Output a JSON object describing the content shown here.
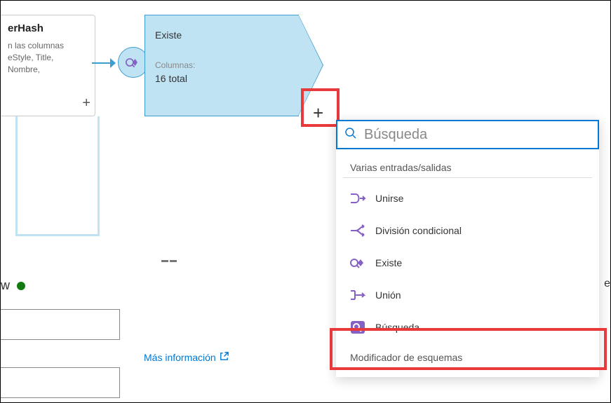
{
  "leftNode": {
    "titleFragment": "erHash",
    "descFragment": "n las columnas\neStyle, Title,\n Nombre,"
  },
  "existsNode": {
    "title": "Existe",
    "columnsLabel": "Columnas:",
    "columnsValue": "16 total"
  },
  "search": {
    "placeholder": "Búsqueda"
  },
  "menu": {
    "sectionA": "Varias entradas/salidas",
    "items": {
      "join": "Unirse",
      "split": "División condicional",
      "exists": "Existe",
      "union": "Unión",
      "lookup": "Búsqueda"
    },
    "sectionB": "Modificador de esquemas"
  },
  "link": {
    "moreInfo": "Más información"
  },
  "status": {
    "letter": "w"
  },
  "rightSliver": "e",
  "colors": {
    "accent": "#0078d4",
    "highlight": "#e83a3a",
    "nodeFill": "#bfe3f3",
    "nodeBorder": "#3c9dd0",
    "purple": "#8661c5"
  }
}
